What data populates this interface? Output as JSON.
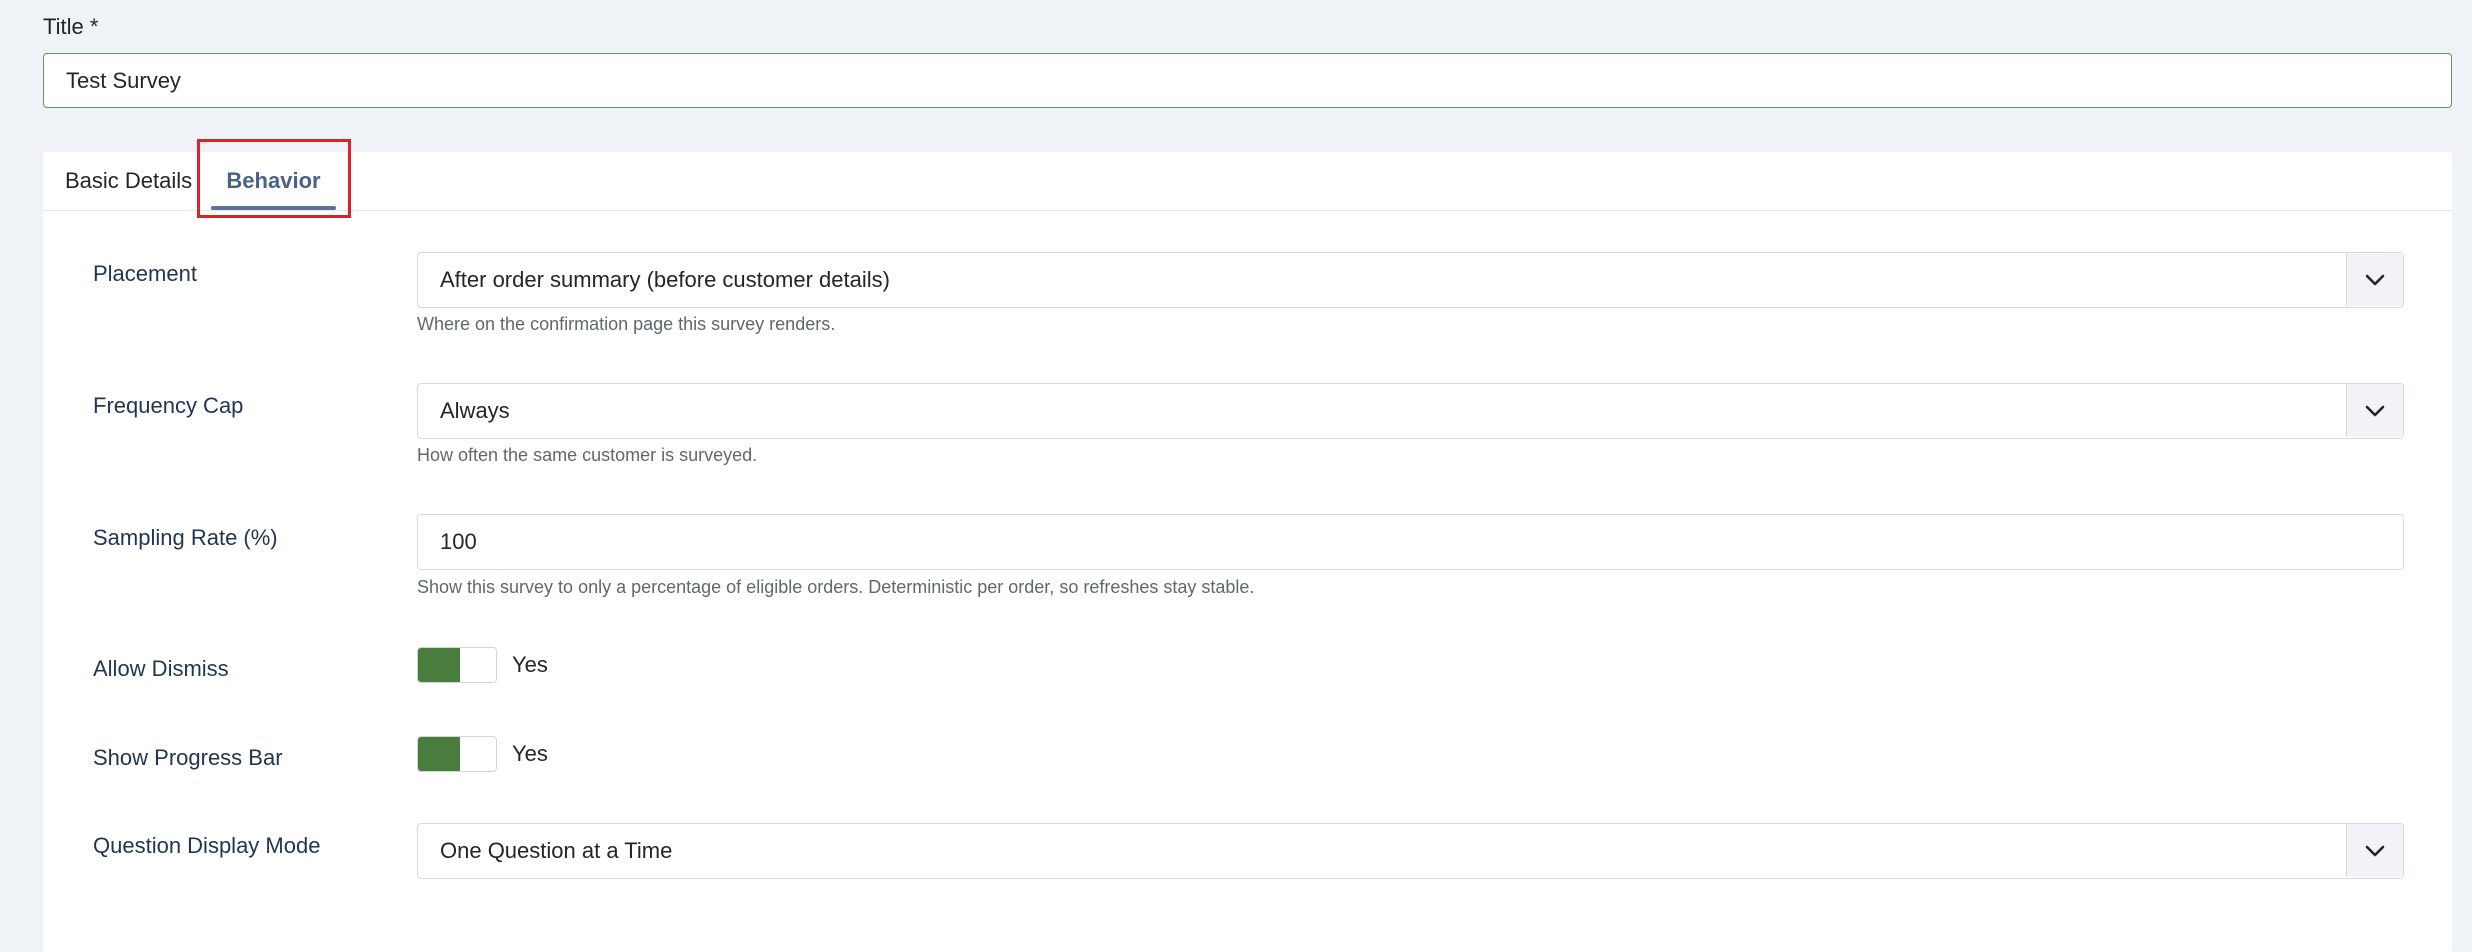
{
  "title_field": {
    "label": "Title *",
    "value": "Test Survey"
  },
  "tabs": [
    {
      "label": "Basic Details",
      "active": false
    },
    {
      "label": "Behavior",
      "active": true
    }
  ],
  "fields": {
    "placement": {
      "label": "Placement",
      "value": "After order summary (before customer details)",
      "help": "Where on the confirmation page this survey renders."
    },
    "frequency_cap": {
      "label": "Frequency Cap",
      "value": "Always",
      "help": "How often the same customer is surveyed."
    },
    "sampling_rate": {
      "label": "Sampling Rate (%)",
      "value": "100",
      "help": "Show this survey to only a percentage of eligible orders. Deterministic per order, so refreshes stay stable."
    },
    "allow_dismiss": {
      "label": "Allow Dismiss",
      "state_text": "Yes",
      "on": true
    },
    "show_progress_bar": {
      "label": "Show Progress Bar",
      "state_text": "Yes",
      "on": true
    },
    "question_display_mode": {
      "label": "Question Display Mode",
      "value": "One Question at a Time"
    }
  },
  "icons": {
    "select_arrow": "chevron-down-icon"
  },
  "colors": {
    "background": "#eff3f8",
    "active_tab": "#4a6285",
    "toggle_on": "#4a7c3d",
    "title_border": "#5d9a5a",
    "highlight": "#e0202a"
  }
}
